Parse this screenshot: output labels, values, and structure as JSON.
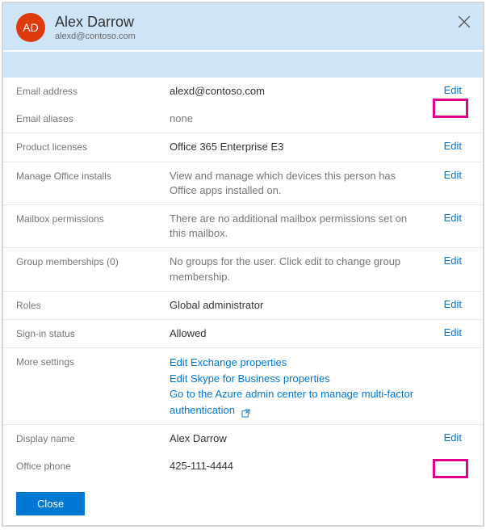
{
  "header": {
    "initials": "AD",
    "display_name": "Alex Darrow",
    "upn": "alexd@contoso.com"
  },
  "rows": {
    "email_address": {
      "label": "Email address",
      "value": "alexd@contoso.com",
      "edit": "Edit"
    },
    "email_aliases": {
      "label": "Email aliases",
      "value": "none"
    },
    "product_licenses": {
      "label": "Product licenses",
      "value": "Office 365 Enterprise E3",
      "edit": "Edit"
    },
    "manage_installs": {
      "label": "Manage Office installs",
      "value": "View and manage which devices this person has Office apps installed on.",
      "edit": "Edit"
    },
    "mailbox_perms": {
      "label": "Mailbox permissions",
      "value": "There are no additional mailbox permissions set on this mailbox.",
      "edit": "Edit"
    },
    "group_memberships": {
      "label": "Group memberships (0)",
      "value": "No groups for the user. Click edit to change group membership.",
      "edit": "Edit"
    },
    "roles": {
      "label": "Roles",
      "value": "Global administrator",
      "edit": "Edit"
    },
    "signin_status": {
      "label": "Sign-in status",
      "value": "Allowed",
      "edit": "Edit"
    },
    "more_settings": {
      "label": "More settings",
      "link1": "Edit Exchange properties",
      "link2": "Edit Skype for Business properties",
      "link3": "Go to the Azure admin center to manage multi-factor authentication"
    },
    "display_name_row": {
      "label": "Display name",
      "value": "Alex Darrow",
      "edit": "Edit"
    },
    "office_phone": {
      "label": "Office phone",
      "value": "425-111-4444"
    }
  },
  "footer": {
    "close": "Close"
  }
}
